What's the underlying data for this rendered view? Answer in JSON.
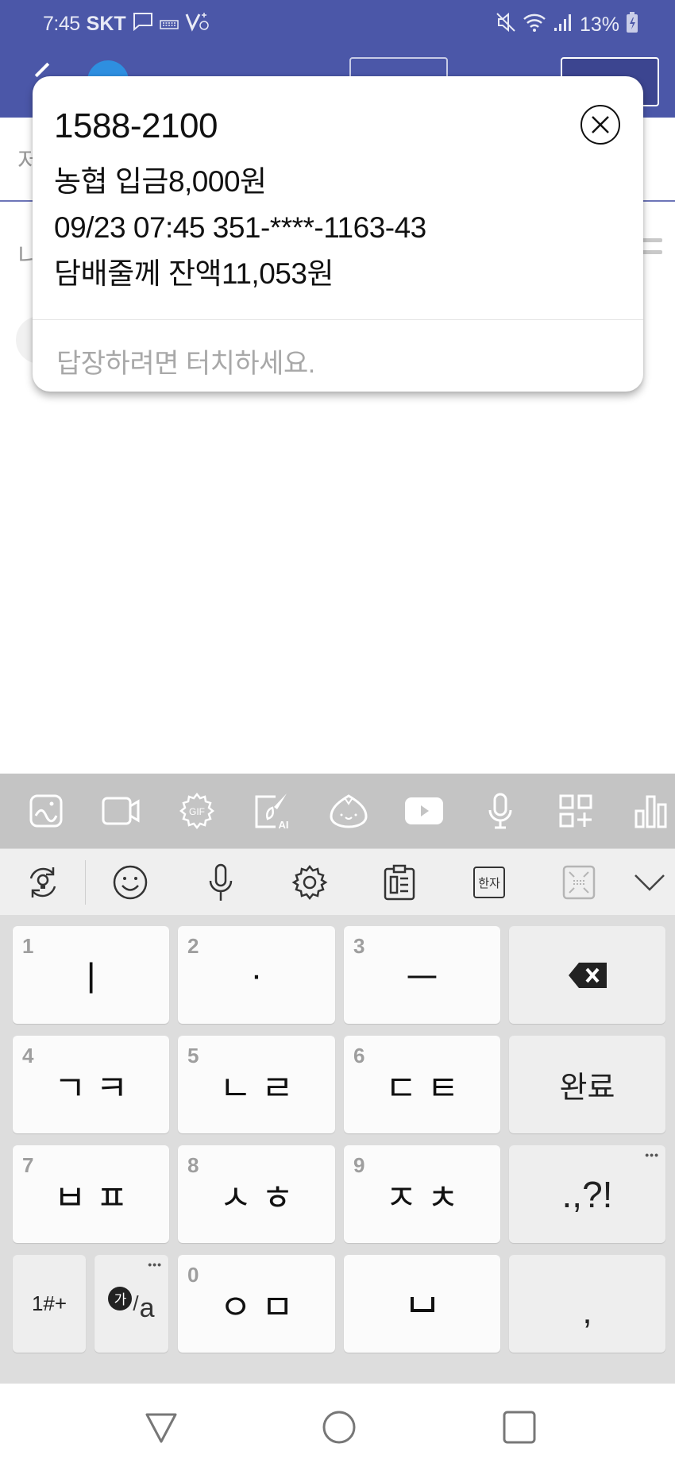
{
  "status_bar": {
    "time": "7:45",
    "carrier": "SKT",
    "battery_percent": "13%",
    "icons": [
      "message-icon",
      "keyboard-icon",
      "volte-icon",
      "mute-icon",
      "wifi-icon",
      "signal-icon",
      "battery-charging-icon"
    ]
  },
  "header": {
    "icons": [
      "back-arrow-icon"
    ]
  },
  "background_page": {
    "row1_fragment": "저",
    "row2_fragment": "니"
  },
  "notification": {
    "sender": "1588-2100",
    "lines": [
      "농협 입금8,000원",
      "09/23 07:45 351-****-1163-43",
      "담배줄께 잔액11,053원"
    ],
    "reply_hint": "답장하려면 터치하세요.",
    "close_icon": "close-circle-icon"
  },
  "keyboard_toolbar": {
    "icons": [
      "image-icon",
      "video-icon",
      "gif-icon",
      "ai-paint-icon",
      "dumpling-emoticon-icon",
      "youtube-icon",
      "microphone-icon",
      "add-grid-icon",
      "bar-chart-icon"
    ]
  },
  "keyboard_bar": {
    "hanja_label": "한자",
    "icons": [
      "idea-refresh-icon",
      "emoji-icon",
      "microphone-icon",
      "settings-icon",
      "clipboard-icon",
      "hanja-icon",
      "keyboard-resize-icon",
      "chevron-down-icon"
    ]
  },
  "keypad": {
    "rows": [
      [
        {
          "num": "1",
          "label": "ㅣ"
        },
        {
          "num": "2",
          "label": "·"
        },
        {
          "num": "3",
          "label": "ㅡ"
        },
        {
          "label": "",
          "icon": "backspace-icon"
        }
      ],
      [
        {
          "num": "4",
          "label": "ㄱ ㅋ"
        },
        {
          "num": "5",
          "label": "ㄴ ㄹ"
        },
        {
          "num": "6",
          "label": "ㄷ ㅌ"
        },
        {
          "label": "완료"
        }
      ],
      [
        {
          "num": "7",
          "label": "ㅂ ㅍ"
        },
        {
          "num": "8",
          "label": "ㅅ ㅎ"
        },
        {
          "num": "9",
          "label": "ㅈ ㅊ"
        },
        {
          "label": ".,?!",
          "more": "•••"
        }
      ],
      [
        {
          "label": "1#+"
        },
        {
          "label_ko": "가",
          "label_en": "a",
          "more": "•••"
        },
        {
          "num": "0",
          "label": "ㅇ ㅁ"
        },
        {
          "label": "␣"
        },
        {
          "label": ","
        }
      ]
    ]
  },
  "nav_bar": {
    "icons": [
      "back-triangle-icon",
      "home-circle-icon",
      "recents-square-icon"
    ]
  }
}
